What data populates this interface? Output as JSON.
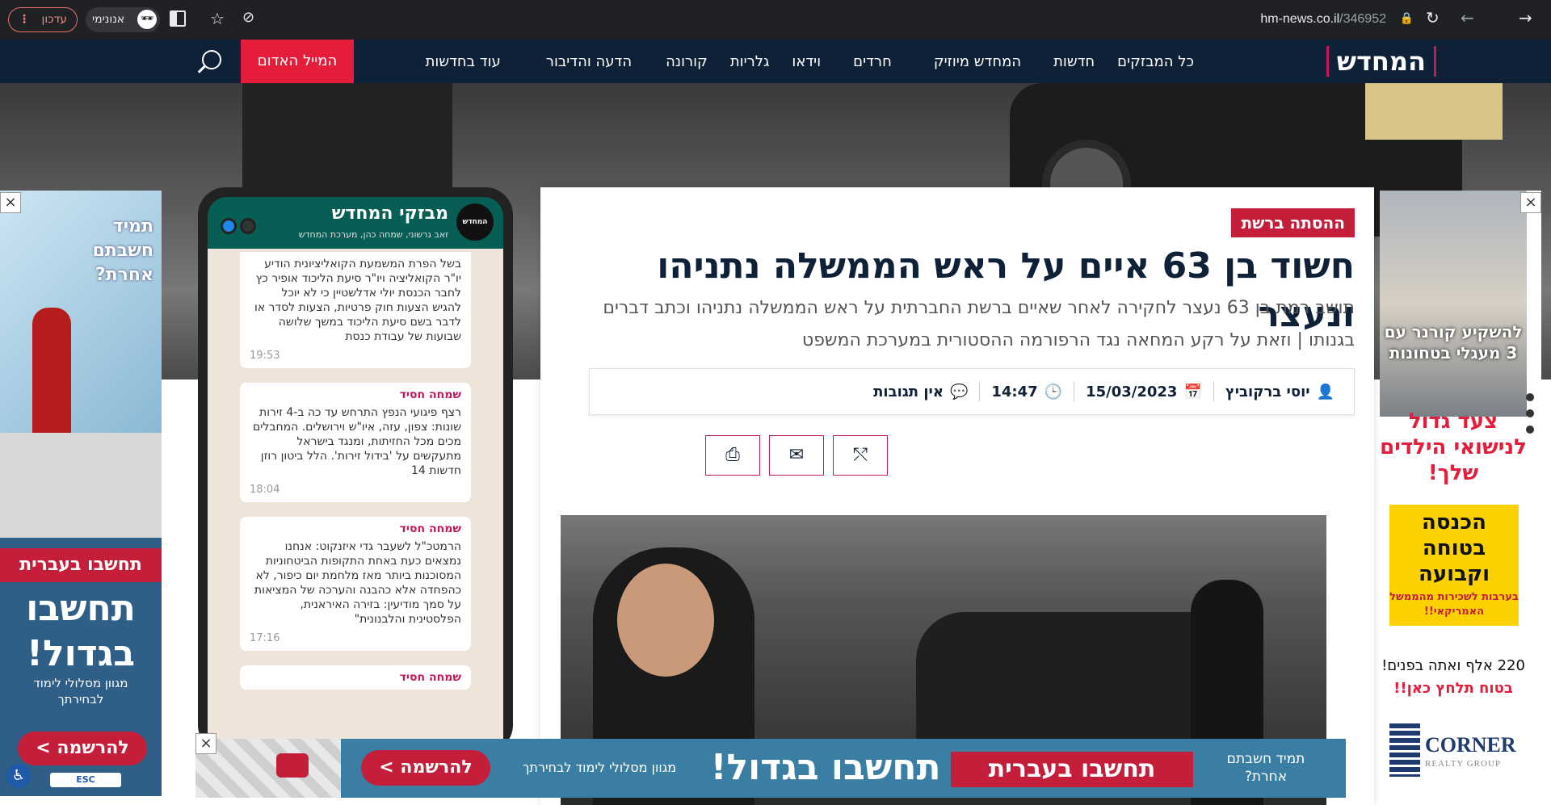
{
  "browser": {
    "url_path": "/346952",
    "url_domain": "hm-news.co.il",
    "update_label": "עדכון",
    "incognito_label": "אנונימי"
  },
  "nav": {
    "logo": "המחדש",
    "items": [
      "כל המבזקים",
      "חדשות",
      "המחדש מיוזיק",
      "חרדים",
      "וידאו",
      "גלריות",
      "קורונה",
      "הדעה והדיבור",
      "עוד בחדשות"
    ],
    "highlight": "המייל האדום"
  },
  "article": {
    "category": "ההסתה ברשת",
    "title": "חשוד בן 63 איים על ראש הממשלה נתניהו ונעצר",
    "subtitle": "תושב רמת בן 63 נעצר לחקירה לאחר שאיים ברשת החברתית על ראש הממשלה נתניהו וכתב דברים בגנותו | וזאת על רקע המחאה נגד הרפורמה ההסטורית במערכת המשפט",
    "author": "יוסי ברקוביץ",
    "date": "15/03/2023",
    "time": "14:47",
    "comments": "אין תגובות"
  },
  "phone": {
    "title": "מבזקי המחדש",
    "subtitle": "זאב גרשוני, שמחה כהן, מערכת המחדש",
    "messages": [
      {
        "author": "",
        "text": "בשל הפרת המשמעת הקואליציונית הודיע יו\"ר הקואליציה ויו\"ר סיעת הליכוד אופיר כץ לחבר הכנסת יולי אדלשטיין כי לא יוכל להגיש הצעות חוק פרטיות, הצעות לסדר או לדבר בשם סיעת הליכוד במשך שלושה שבועות של עבודת כנסת",
        "time": "19:53"
      },
      {
        "author": "שמחה חסיד",
        "text": "רצף פיגועי הנפץ התרחש עד כה ב-4 זירות שונות: צפון, עזה, איו\"ש וירושלים. המחבלים מכים מכל החזיתות, ומנגד בישראל מתעקשים על 'בידול זירות'. הלל ביטון רוזן חדשות 14",
        "time": "18:04"
      },
      {
        "author": "שמחה חסיד",
        "text": "הרמטכ\"ל לשעבר גדי איזנקוט: אנחנו נמצאים כעת באחת התקופות הביטחוניות המסוכנות ביותר מאז מלחמת יום כיפור, לא כהפחדה אלא כהבנה והערכה של המציאות על סמך מודיעין: בזירה האיראנית, הפלסטינית והלבנונית\"",
        "time": "17:16"
      },
      {
        "author": "שמחה חסיד",
        "text": "",
        "time": ""
      }
    ]
  },
  "ads": {
    "left_top": "תמיד חשבתם אחרת?",
    "left_banner": "תחשבו בעברית",
    "left_big": "תחשבו בגדול!",
    "left_sub": "מגוון מסלולי לימוד לבחירתך",
    "left_cta": "להרשמה >",
    "esc": "ESC",
    "right_top": "להשקיע קורנר עם 3 מעגלי בטחונות",
    "right_mid": "צעד גדול לנישואי הילדים שלך!",
    "right_yellow": "הכנסה בטוחה וקבועה",
    "right_yellow_sub": "בערבות לשכירות מהממשל האמריקאי!!",
    "right_line1": "220 אלף ואתה בפנים!",
    "right_line2": "בטוח תלחץ כאן!!",
    "right_logo": "CORNER",
    "right_logo_sub": "REALTY GROUP",
    "bottom_big": "תחשבו בגדול!",
    "bottom_banner": "תחשבו בעברית",
    "bottom_top": "תמיד חשבתם אחרת?",
    "bottom_cta": "להרשמה >",
    "bottom_sub": "מגוון מסלולי לימוד לבחירתך"
  }
}
